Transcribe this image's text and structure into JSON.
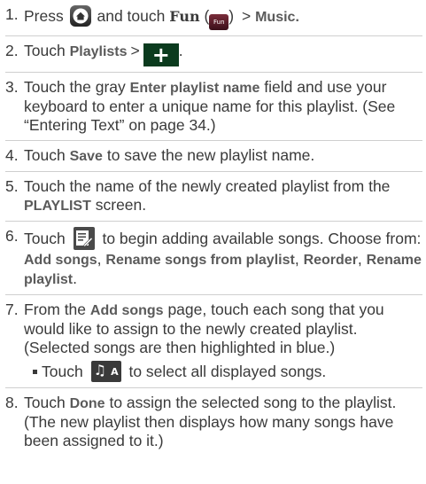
{
  "steps": [
    {
      "num": "1.",
      "pre": "Press",
      "mid": "and touch",
      "fun": "Fun",
      "icon_text": "Fun",
      "paren_open": "(",
      "paren_close": ")",
      "gt": ">",
      "music": "Music."
    },
    {
      "num": "2.",
      "pre": "Touch",
      "bold": "Playlists",
      "gt": ">",
      "plus": "+",
      "dot": "."
    },
    {
      "num": "3.",
      "pre": "Touch the gray",
      "bold": "Enter playlist name",
      "rest": "field and use your keyboard to enter a unique name for this playlist. (See “Entering Text” on page 34.)"
    },
    {
      "num": "4.",
      "pre": "Touch",
      "bold": "Save",
      "rest": "to save the new playlist name."
    },
    {
      "num": "5.",
      "pre": "Touch the name of the newly created playlist from the",
      "bold": "PLAYLIST",
      "rest": "screen."
    },
    {
      "num": "6.",
      "pre": "Touch",
      "rest1": "to begin adding available songs. Choose from:",
      "opt1": "Add songs",
      "sep1": ",",
      "opt2": "Rename songs from playlist",
      "sep2": ",",
      "opt3": "Reorder",
      "sep3": ",",
      "opt4": "Rename playlist",
      "end": "."
    },
    {
      "num": "7.",
      "pre": "From the",
      "bold": "Add songs",
      "rest": "page, touch each song that you would like to assign to the newly created playlist. (Selected songs are then highlighted in blue.)",
      "sub_pre": "Touch",
      "sub_rest": "to select all displayed songs.",
      "icon_letter": "A"
    },
    {
      "num": "8.",
      "pre": "Touch",
      "bold": "Done",
      "rest": "to assign the selected song to the playlist. (The new playlist then displays how many songs have been assigned to it.)"
    }
  ],
  "icons": {
    "home": "home-key-icon",
    "fun": "fun-app-icon",
    "plus": "add-playlist-icon",
    "edit": "edit-playlist-icon",
    "select_all": "select-all-songs-icon"
  },
  "colors": {
    "text": "#3a3a3a",
    "bold_text": "#5a5a5a",
    "plus_bg": "#0b3b1e",
    "icon_dark": "#3a3a3a"
  }
}
